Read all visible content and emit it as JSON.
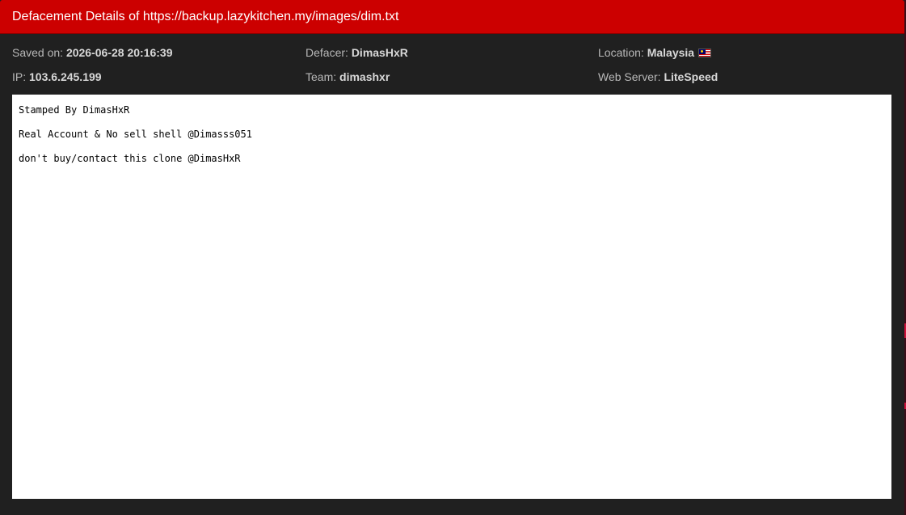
{
  "header": {
    "title": "Defacement Details of https://backup.lazykitchen.my/images/dim.txt"
  },
  "details": {
    "saved_on": {
      "label": "Saved on:",
      "value": "2026-06-28 20:16:39"
    },
    "defacer": {
      "label": "Defacer:",
      "value": "DimasHxR"
    },
    "location": {
      "label": "Location:",
      "value": "Malaysia",
      "flag_icon": "malaysia-flag-icon"
    },
    "ip": {
      "label": "IP:",
      "value": "103.6.245.199"
    },
    "team": {
      "label": "Team:",
      "value": "dimashxr"
    },
    "web_server": {
      "label": "Web Server:",
      "value": "LiteSpeed"
    }
  },
  "mirror_content": {
    "lines": [
      "Stamped By DimasHxR",
      "Real Account & No sell shell @Dimasss051",
      "don't buy/contact this clone @DimasHxR"
    ]
  },
  "colors": {
    "header_bg": "#cc0000",
    "panel_bg": "#202020",
    "label_text": "#b8b8b8",
    "value_text": "#d8d8d8",
    "content_bg": "#ffffff"
  }
}
